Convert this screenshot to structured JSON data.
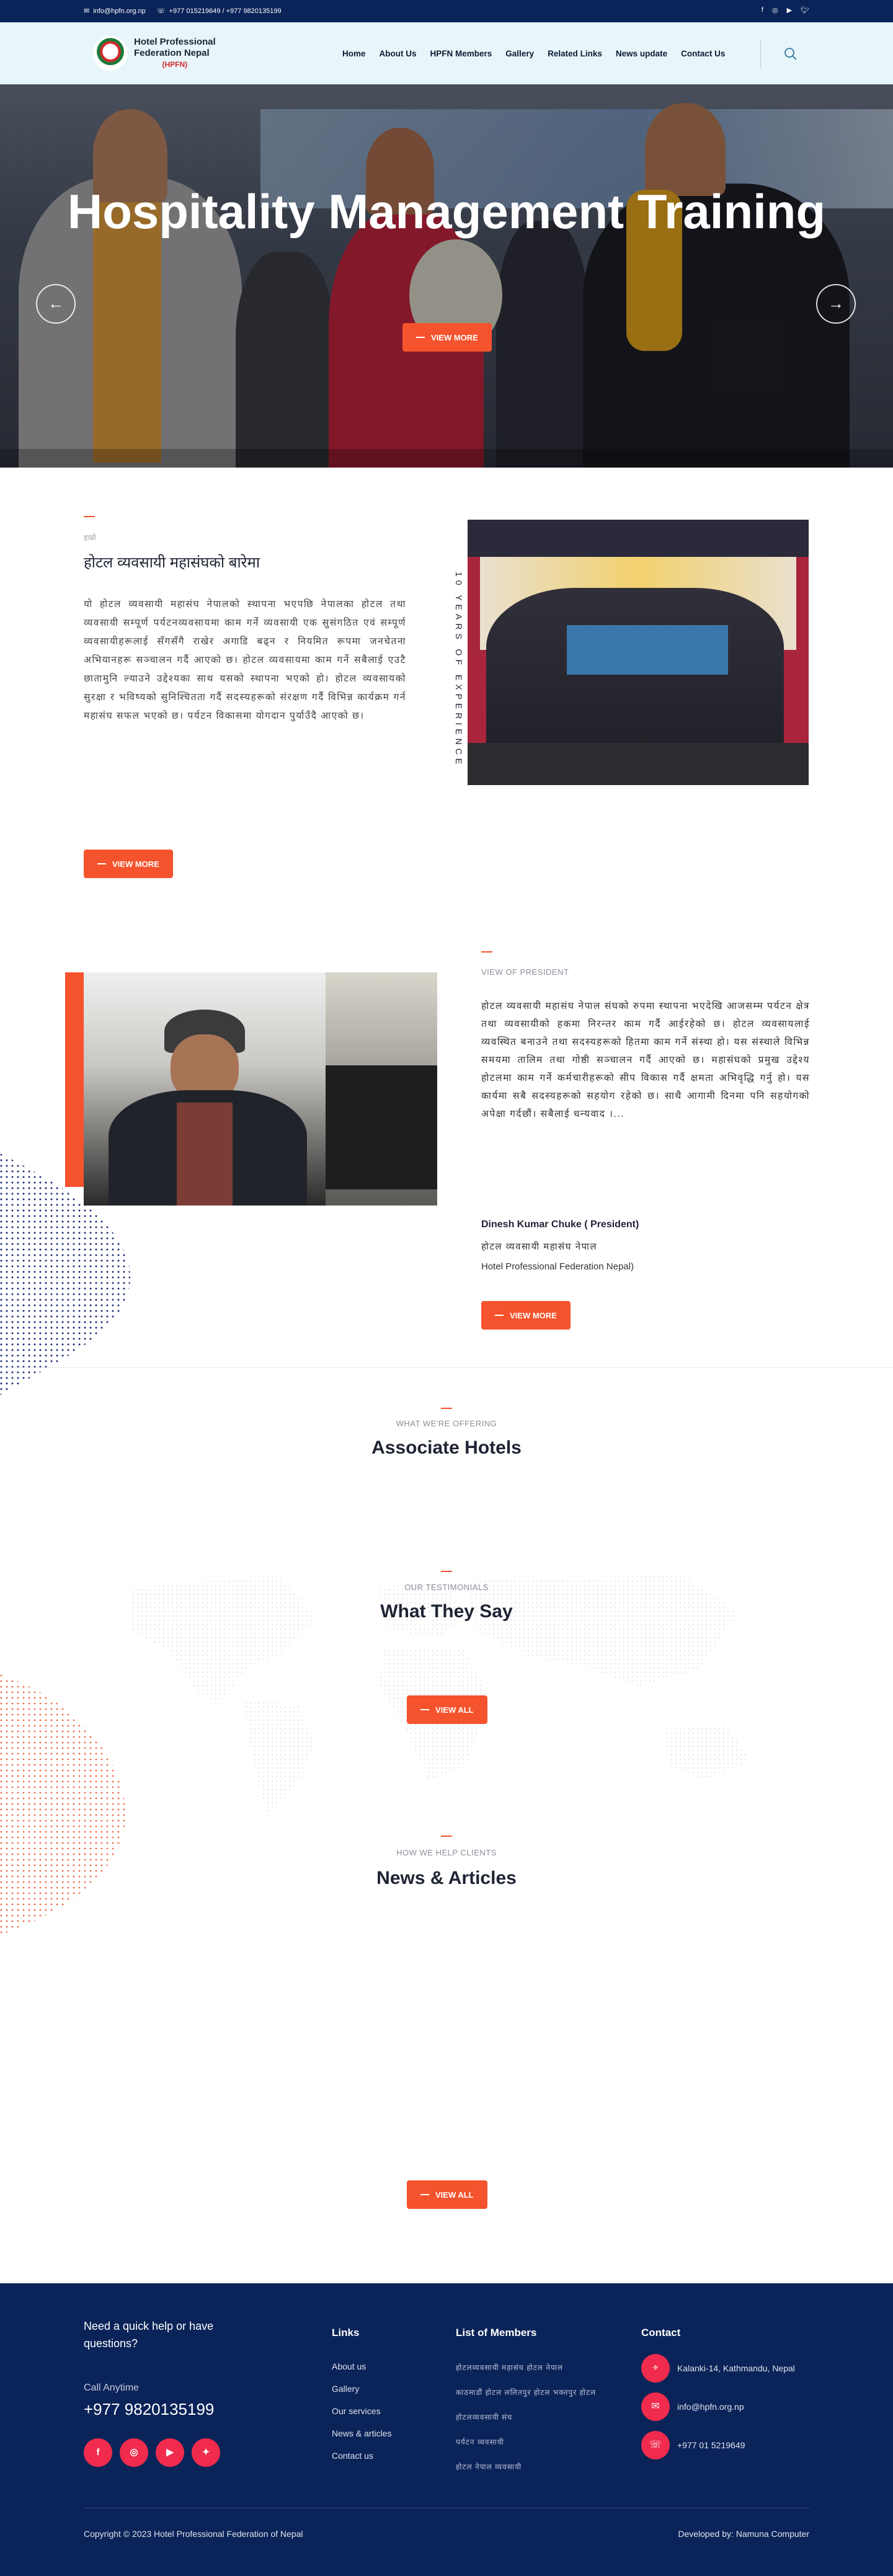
{
  "topbar": {
    "email": "info@hpfn.org.np",
    "phones": "+977 015219649 / +977 9820135199",
    "socials": [
      "facebook-icon",
      "instagram-icon",
      "youtube-icon",
      "twitter-icon"
    ]
  },
  "header": {
    "logo_line1": "Hotel Professional",
    "logo_line2": "Federation Nepal",
    "logo_abbr": "(HPFN)",
    "nav": [
      "Home",
      "About Us",
      "HPFN Members",
      "Gallery",
      "Related Links",
      "News update",
      "Contact Us"
    ]
  },
  "hero": {
    "title": "Hospitality Management Training",
    "button": "VIEW MORE"
  },
  "about": {
    "label": "हाम्रो",
    "title": "होटल व्यवसायी महासंघको बारेमा",
    "vertical": "10 YEARS OF EXPERIENCE",
    "body": "यो होटल व्यवसायी महासंघ नेपालको स्थापना भएपछि  नेपालका होटल तथा व्यवसायी सम्पूर्ण पर्यटनव्यवसायमा काम गर्ने व्यवसायी एक सुसंगठित एवं सम्पूर्ण व्यवसायीहरूलाई सँगसँगै राखेर अगाडि बढ्न र नियमित रूपमा जनचेतना अभियानहरू सञ्चालन गर्दै आएको छ। होटल व्यवसायमा काम गर्ने सबैलाई एउटै छातामुनि ल्याउने उद्देश्यका साथ यसको स्थापना भएको हो। होटल व्यवसायको सुरक्षा र भविष्यको सुनिश्चितता गर्दै सदस्यहरूको संरक्षण गर्दै विभिन्न कार्यक्रम गर्न महासंघ सफल भएको छ। पर्यटन विकासमा योगदान पुर्याउँदै आएको छ।",
    "button": "VIEW MORE"
  },
  "president": {
    "label": "VIEW OF PRESIDENT",
    "body": "होटल व्यवसायी महासंघ नेपाल संघको रुपमा स्थापना भएदेखि आजसम्म पर्यटन क्षेत्र तथा व्यवसायीको हकमा निरन्तर काम गर्दै आईरहेको छ। होटल व्यवसायलाई व्यवस्थित बनाउने तथा सदस्यहरूको हितमा काम गर्ने संस्था हो। यस संस्थाले विभिन्न समयमा तालिम तथा गोष्ठी सञ्चालन गर्दै आएको छ। महासंघको प्रमुख उद्देश्य होटलमा काम गर्ने कर्मचारीहरूको सीप विकास गर्दै क्षमता अभिवृद्धि गर्नु हो। यस कार्यमा सबै सदस्यहरूको सहयोग रहेको छ। साथै आगामी दिनमा पनि सहयोगको अपेक्षा गर्दछौं। सबैलाई धन्यवाद ।...",
    "name": "Dinesh Kumar Chuke ( President)",
    "role": "होटल व्यवसायी महासंघ नेपाल",
    "org": "Hotel Professional Federation Nepal)",
    "button": "VIEW MORE"
  },
  "associate": {
    "sub": "WHAT WE'RE OFFERING",
    "title": "Associate Hotels"
  },
  "testimonials": {
    "sub": "OUR TESTIMONIALS",
    "title": "What They Say",
    "button": "VIEW ALL"
  },
  "news": {
    "sub": "HOW WE HELP CLIENTS",
    "title": "News & Articles",
    "button": "VIEW ALL"
  },
  "footer": {
    "help": "Need a quick help or have questions?",
    "call_label": "Call Anytime",
    "phone": "+977 9820135199",
    "socials": [
      "f",
      "ig",
      "yt",
      "tw"
    ],
    "links_title": "Links",
    "links": [
      "About us",
      "Gallery",
      "Our services",
      "News & articles",
      "Contact us"
    ],
    "members_title": "List of Members",
    "members": [
      "होटलव्यवसायी महासंघ   होटल नेपाल",
      "काठमाडौं होटल   ललितपुर होटल   भक्तपुर होटल",
      "होटलव्यवसायी संघ",
      "पर्यटन व्यवसायी",
      "होटल नेपाल व्यवसायी"
    ],
    "contact_title": "Contact",
    "contact": [
      "Kalanki-14, Kathmandu, Nepal",
      "info@hpfn.org.np",
      "+977 01 5219649"
    ],
    "copyright": "Copyright © 2023 Hotel Professional Federation of Nepal",
    "developer": "Developed by: Namuna Computer"
  },
  "colors": {
    "navy": "#0a2358",
    "accent": "#f5532d",
    "header_bg": "#e8f6fb",
    "social": "#f02b4d"
  }
}
